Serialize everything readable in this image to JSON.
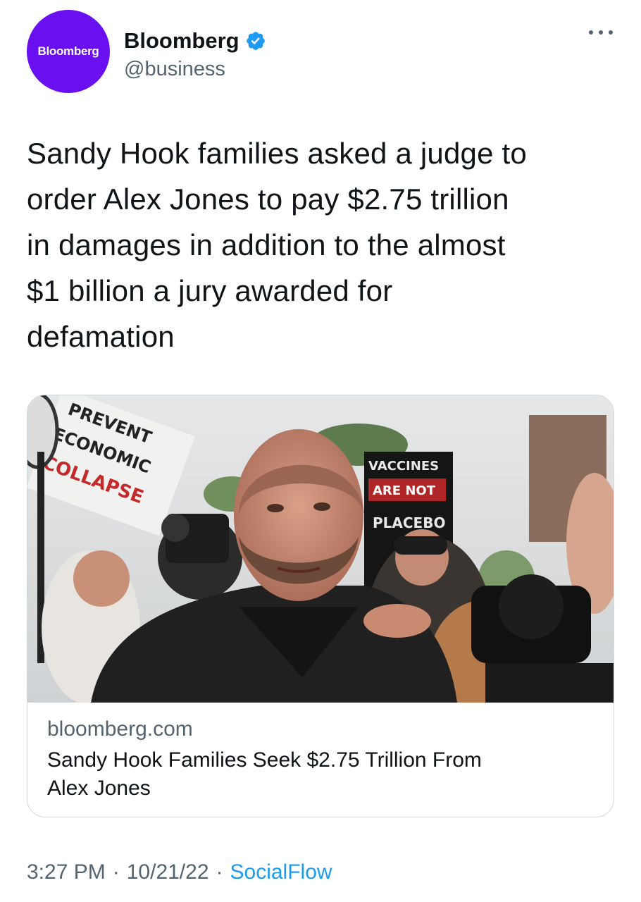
{
  "author": {
    "avatar_text": "Bloomberg",
    "display_name": "Bloomberg",
    "handle": "@business",
    "verified": true,
    "avatar_color": "#6a0ff0",
    "verified_color": "#1d9bf0"
  },
  "tweet": {
    "text_lines": [
      "Sandy Hook families asked a judge to",
      "order Alex Jones to pay $2.75 trillion",
      "in damages in addition to the almost",
      "$1 billion a jury awarded for",
      "defamation"
    ]
  },
  "card": {
    "image_signs": {
      "left_sign": [
        "PREVENT",
        "ECONOMIC",
        "COLLAPSE"
      ],
      "right_sign": [
        "VACCINES",
        "ARE NOT",
        "PLACEBO"
      ]
    },
    "domain": "bloomberg.com",
    "title_lines": [
      "Sandy Hook Families Seek $2.75 Trillion From",
      "Alex Jones"
    ]
  },
  "meta": {
    "time": "3:27 PM",
    "date": "10/21/22",
    "separator": "·",
    "source": "SocialFlow",
    "link_color": "#1d9bf0"
  },
  "icons": {
    "more": "more-horizontal-icon",
    "verified": "verified-badge-icon"
  }
}
